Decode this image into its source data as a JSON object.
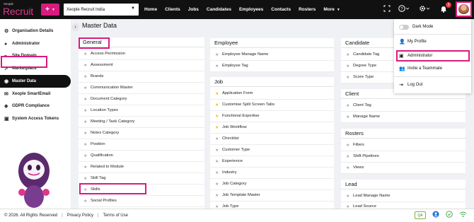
{
  "brand": {
    "small": "Xeople",
    "name": "Recruit",
    "accent": "#d81b7d"
  },
  "topbar": {
    "add_label": "+",
    "tenant": "Xeople Recruit India",
    "nav": [
      "Home",
      "Clients",
      "Jobs",
      "Candidates",
      "Employees",
      "Contacts",
      "Rosters",
      "More"
    ],
    "notification_count": "3"
  },
  "sidebar": {
    "items": [
      {
        "label": "Organisation Details",
        "icon": "gear-icon"
      },
      {
        "label": "Administrator",
        "icon": "user-icon"
      },
      {
        "label": "Site Domain",
        "icon": "link-icon"
      },
      {
        "label": "Marketplace",
        "icon": "rocket-icon"
      },
      {
        "label": "Master Data",
        "icon": "database-icon"
      },
      {
        "label": "Xeople SmartEmail",
        "icon": "envelope-icon"
      },
      {
        "label": "GDPR Compliance",
        "icon": "shield-icon"
      },
      {
        "label": "System Access Tokens",
        "icon": "box-icon"
      }
    ],
    "active_index": 4
  },
  "main": {
    "title": "Master Data",
    "general": {
      "title": "General",
      "items": [
        "Access Permission",
        "Assessment",
        "Brands",
        "Communication Master",
        "Document Category",
        "Location Types",
        "Meeting / Task Category",
        "Notes Category",
        "Position",
        "Qualification",
        "Related to Module",
        "Skill Tag",
        "Skills",
        "Social Profiles"
      ]
    },
    "employee": {
      "title": "Employee",
      "items": [
        "Employee Manage Name",
        "Employee Tag"
      ]
    },
    "job": {
      "title": "Job",
      "items": [
        {
          "label": "Application Form",
          "starred": true
        },
        {
          "label": "Customise Split Screen Tabs",
          "starred": true
        },
        {
          "label": "Functional Expertise",
          "starred": true
        },
        {
          "label": "Job Workflow",
          "starred": true
        },
        {
          "label": "Checklist",
          "starred": false
        },
        {
          "label": "Customer Type",
          "starred": false
        },
        {
          "label": "Experience",
          "starred": false
        },
        {
          "label": "Industry",
          "starred": false
        },
        {
          "label": "Job Category",
          "starred": false
        },
        {
          "label": "Job Template Master",
          "starred": false
        },
        {
          "label": "Job Type",
          "starred": false
        }
      ]
    },
    "candidate": {
      "title": "Candidate",
      "items": [
        "Candidate Tag",
        "Degree Type",
        "Score Type"
      ]
    },
    "client": {
      "title": "Client",
      "items": [
        "Client Tag",
        "Manage Name"
      ]
    },
    "rosters": {
      "title": "Rosters",
      "items": [
        "Filters",
        "Shift Pipelines",
        "Views"
      ]
    },
    "lead": {
      "title": "Lead",
      "items": [
        "Lead Manage Name",
        "Lead Source"
      ]
    }
  },
  "dropdown": {
    "dark_mode": "Dark Mode",
    "items": [
      "My Profile",
      "Administrator",
      "Invite a Teammate",
      "Log Out"
    ]
  },
  "footer": {
    "copyright": "© 2026. All Rights Reserved",
    "privacy": "Privacy Policy",
    "terms": "Terms of Use",
    "qa": "QA"
  }
}
